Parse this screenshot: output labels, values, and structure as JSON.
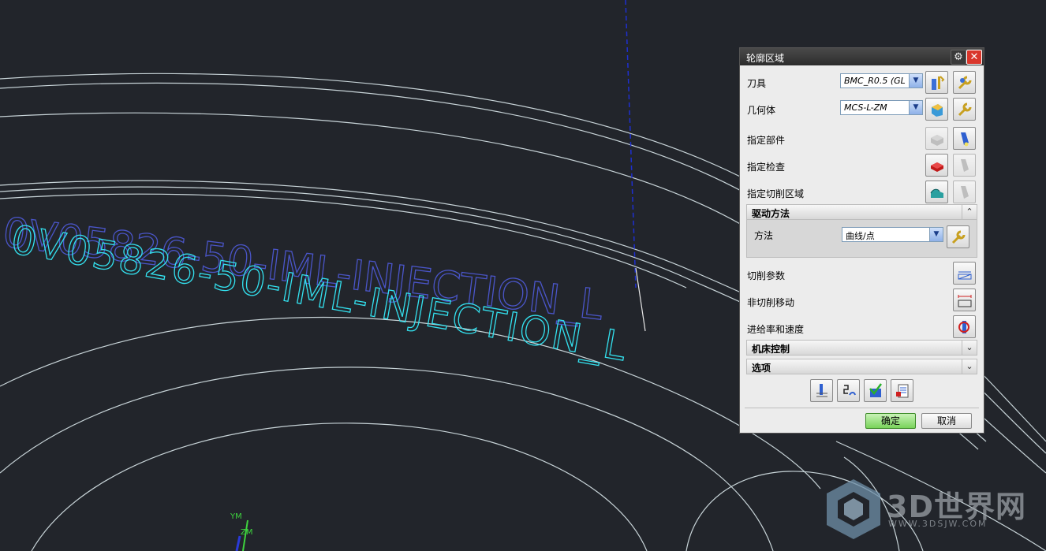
{
  "dialog": {
    "title": "轮廓区域",
    "rows": {
      "tool_label": "刀具",
      "tool_value": "BMC_R0.5 (GL",
      "geometry_label": "几何体",
      "geometry_value": "MCS-L-ZM",
      "specify_part_label": "指定部件",
      "specify_check_label": "指定检查",
      "specify_cut_area_label": "指定切削区域"
    },
    "drive_method": {
      "header": "驱动方法",
      "method_label": "方法",
      "method_value": "曲线/点"
    },
    "cutting_params_label": "切削参数",
    "non_cutting_moves_label": "非切削移动",
    "feeds_speeds_label": "进给率和速度",
    "machine_control_header": "机床控制",
    "options_header": "选项",
    "ok_label": "确定",
    "cancel_label": "取消"
  },
  "viewport": {
    "text_outline": "0V05826-50-IML-INJECTION_L",
    "text_projected": "0V05826-50-IML-INJECTION_L",
    "axis_labels": {
      "ym": "YM",
      "zm": "ZM"
    }
  },
  "watermark": {
    "brand": "3D世界网",
    "url": "WWW.3DSJW.COM"
  },
  "colors": {
    "background": "#22252b",
    "curve": "#c8d4d8",
    "outline_text": "#4a55c8",
    "projected_text": "#33e0ee",
    "ok_button": "#79d35a",
    "close_button": "#d9362b"
  }
}
